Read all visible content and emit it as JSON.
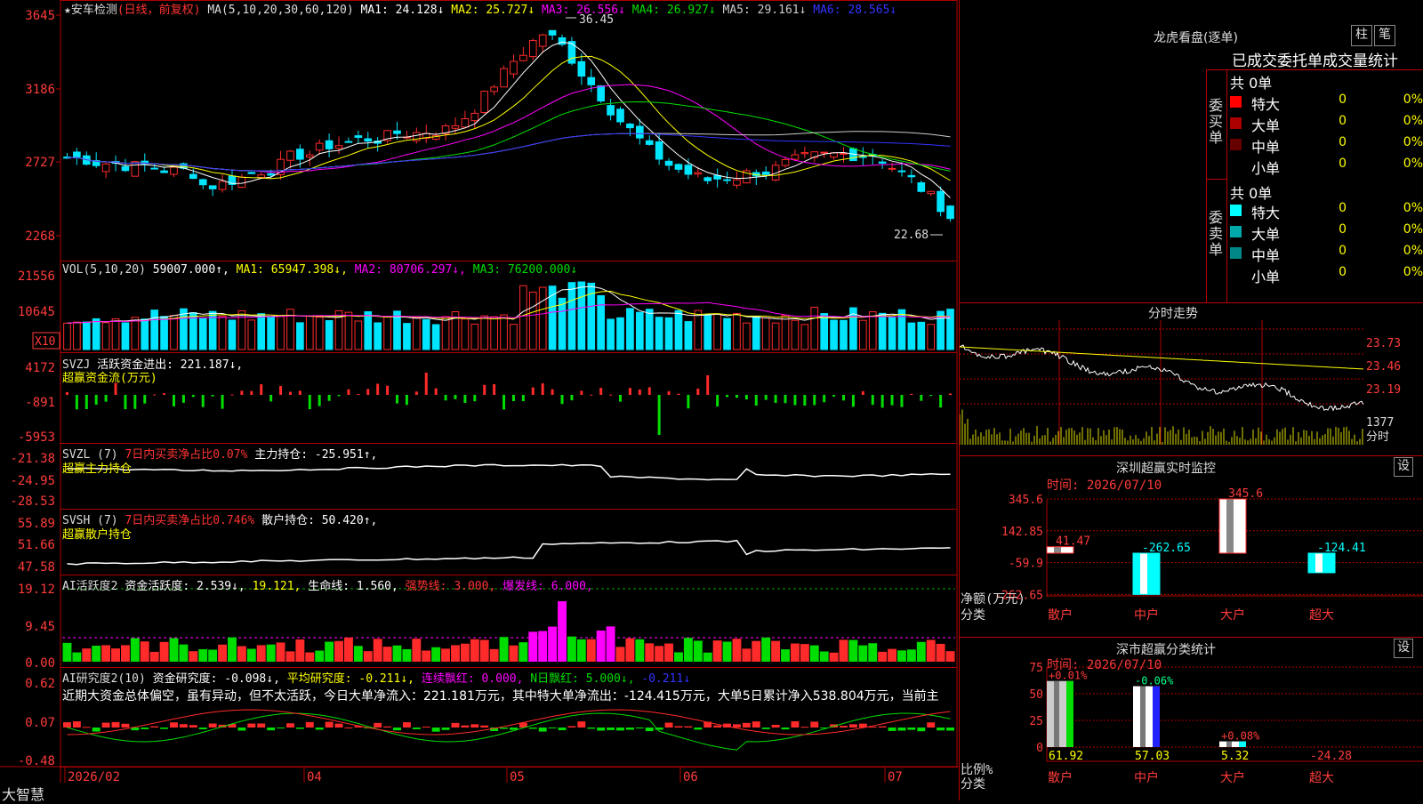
{
  "stock": {
    "star": "★",
    "name": "安车检测",
    "period": "(日线，前复权)"
  },
  "colors": {
    "up": "#ff2a2a",
    "down": "#00e5ff",
    "grid": "#b00000",
    "axis_text": "#ff3b3b",
    "ma1": "#ffffff",
    "ma2": "#ffff00",
    "ma3": "#ff00ff",
    "ma4": "#00dd00",
    "ma5": "#cccccc",
    "ma6": "#3333ff"
  },
  "main": {
    "ma_header": [
      {
        "text": "MA(5,10,20,30,60,120)",
        "color": "#dddddd"
      },
      {
        "text": "MA1: 24.128↓",
        "color": "#ffffff"
      },
      {
        "text": "MA2: 25.727↓",
        "color": "#ffff00"
      },
      {
        "text": "MA3: 26.556↓",
        "color": "#ff00ff"
      },
      {
        "text": "MA4: 26.927↓",
        "color": "#00dd00"
      },
      {
        "text": "MA5: 29.161↓",
        "color": "#cccccc"
      },
      {
        "text": "MA6: 28.565↓",
        "color": "#3333ff"
      }
    ],
    "yticks": [
      "3645",
      "3186",
      "2727",
      "2268"
    ],
    "high_label": "36.45",
    "low_label": "22.68"
  },
  "vol": {
    "header": [
      {
        "text": "VOL(5,10,20)",
        "color": "#dddddd"
      },
      {
        "text": "59007.000↑,",
        "color": "#ffffff"
      },
      {
        "text": "MA1: 65947.398↓,",
        "color": "#ffff00"
      },
      {
        "text": "MA2: 80706.297↓,",
        "color": "#ff00ff"
      },
      {
        "text": "MA3: 76200.000↓",
        "color": "#00dd00"
      }
    ],
    "yticks": [
      "21556",
      "10645"
    ],
    "unit": "X10"
  },
  "svzj": {
    "header": [
      {
        "text": "SVZJ",
        "color": "#dddddd"
      },
      {
        "text": "活跃资金进出: 221.187↓,",
        "color": "#ffffff"
      }
    ],
    "sub": "超赢资金流(万元)",
    "yticks": [
      "4172",
      "-891",
      "-5953"
    ]
  },
  "svzl": {
    "header": [
      {
        "text": "SVZL (7)",
        "color": "#dddddd"
      },
      {
        "text": "7日内买卖净占比0.07%",
        "color": "#ff3333"
      },
      {
        "text": "主力持仓: -25.951↑,",
        "color": "#ffffff"
      }
    ],
    "sub": "超赢主力持仓",
    "yticks": [
      "-21.38",
      "-24.95",
      "-28.53"
    ]
  },
  "svsh": {
    "header": [
      {
        "text": "SVSH (7)",
        "color": "#dddddd"
      },
      {
        "text": "7日内买卖净占比0.746%",
        "color": "#ff3333"
      },
      {
        "text": "散户持仓: 50.420↑,",
        "color": "#ffffff"
      }
    ],
    "sub": "超赢散户持仓",
    "yticks": [
      "55.89",
      "51.66",
      "47.58"
    ]
  },
  "ai_act": {
    "header": [
      {
        "text": "AI活跃度2",
        "color": "#dddddd"
      },
      {
        "text": "资金活跃度: 2.539↓,",
        "color": "#ffffff"
      },
      {
        "text": "19.121,",
        "color": "#ffff00"
      },
      {
        "text": "生命线: 1.560,",
        "color": "#ffffff"
      },
      {
        "text": "强势线: 3.000,",
        "color": "#ff3333"
      },
      {
        "text": "爆发线: 6.000,",
        "color": "#ff00ff"
      }
    ],
    "yticks": [
      "19.12",
      "9.45",
      "0.00"
    ]
  },
  "ai_res": {
    "header": [
      {
        "text": "AI研究度2(10)",
        "color": "#dddddd"
      },
      {
        "text": "资金研究度: -0.098↓,",
        "color": "#ffffff"
      },
      {
        "text": "平均研究度: -0.211↓,",
        "color": "#ffff00"
      },
      {
        "text": "连续飘红: 0.000,",
        "color": "#ff00ff"
      },
      {
        "text": "N日飘红: 5.000↓,",
        "color": "#00dd00"
      },
      {
        "text": "-0.211↓",
        "color": "#3333ff"
      }
    ],
    "summary": "近期大资金总体偏空，虽有异动，但不太活跃，今日大单净流入：221.181万元，其中特大单净流出：-124.415万元，大单5日累计净入538.804万元，当前主",
    "yticks": [
      "0.62",
      "0.07",
      "-0.48"
    ]
  },
  "xaxis": [
    "2026/02",
    "04",
    "05",
    "06",
    "07"
  ],
  "brand": "大智慧",
  "lhb": {
    "title": "龙虎看盘(逐单)",
    "btn_col": "柱",
    "btn_pen": "笔",
    "subtitle": "已成交委托单成交量统计",
    "buy": {
      "side": "委买单",
      "total": "共 0单",
      "rows": [
        {
          "label": "特大",
          "count": "0",
          "pct": "0%",
          "color": "#ff0000"
        },
        {
          "label": "大单",
          "count": "0",
          "pct": "0%",
          "color": "#aa0000"
        },
        {
          "label": "中单",
          "count": "0",
          "pct": "0%",
          "color": "#660000"
        },
        {
          "label": "小单",
          "count": "0",
          "pct": "0%",
          "color": "#000000"
        }
      ]
    },
    "sell": {
      "side": "委卖单",
      "total": "共 0单",
      "rows": [
        {
          "label": "特大",
          "count": "0",
          "pct": "0%",
          "color": "#00ffff"
        },
        {
          "label": "大单",
          "count": "0",
          "pct": "0%",
          "color": "#00aaaa"
        },
        {
          "label": "中单",
          "count": "0",
          "pct": "0%",
          "color": "#008888"
        },
        {
          "label": "小单",
          "count": "0",
          "pct": "0%",
          "color": "#000000"
        }
      ]
    }
  },
  "intraday": {
    "title": "分时走势",
    "yticks": [
      "23.73",
      "23.46",
      "23.19"
    ],
    "vol_label": "1377",
    "unit": "分时"
  },
  "monitor": {
    "title": "深圳超赢实时监控",
    "setting": "设",
    "time": "时间: 2026/07/10",
    "yticks": [
      "345.6",
      "142.85",
      "-59.9",
      "-262.65"
    ],
    "ylabel": "净额(万元)",
    "xlabel": "分类",
    "categories": [
      "散户",
      "中户",
      "大户",
      "超大"
    ],
    "values": [
      41.47,
      -262.65,
      345.6,
      -124.41
    ],
    "value_labels": [
      "41.47",
      "-262.65",
      "345.6",
      "-124.41"
    ]
  },
  "classify": {
    "title": "深市超赢分类统计",
    "setting": "设",
    "time": "时间: 2026/07/10",
    "yticks": [
      "75",
      "50",
      "25",
      "0"
    ],
    "ylabel": "比例%",
    "xlabel": "分类",
    "categories": [
      "散户",
      "中户",
      "大户",
      "超大"
    ],
    "values": [
      61.92,
      57.03,
      5.32,
      -24.28
    ],
    "value_labels": [
      "61.92",
      "57.03",
      "5.32",
      "-24.28"
    ],
    "changes": [
      "+0.01%",
      "-0.06%",
      "+0.08%",
      ""
    ]
  }
}
